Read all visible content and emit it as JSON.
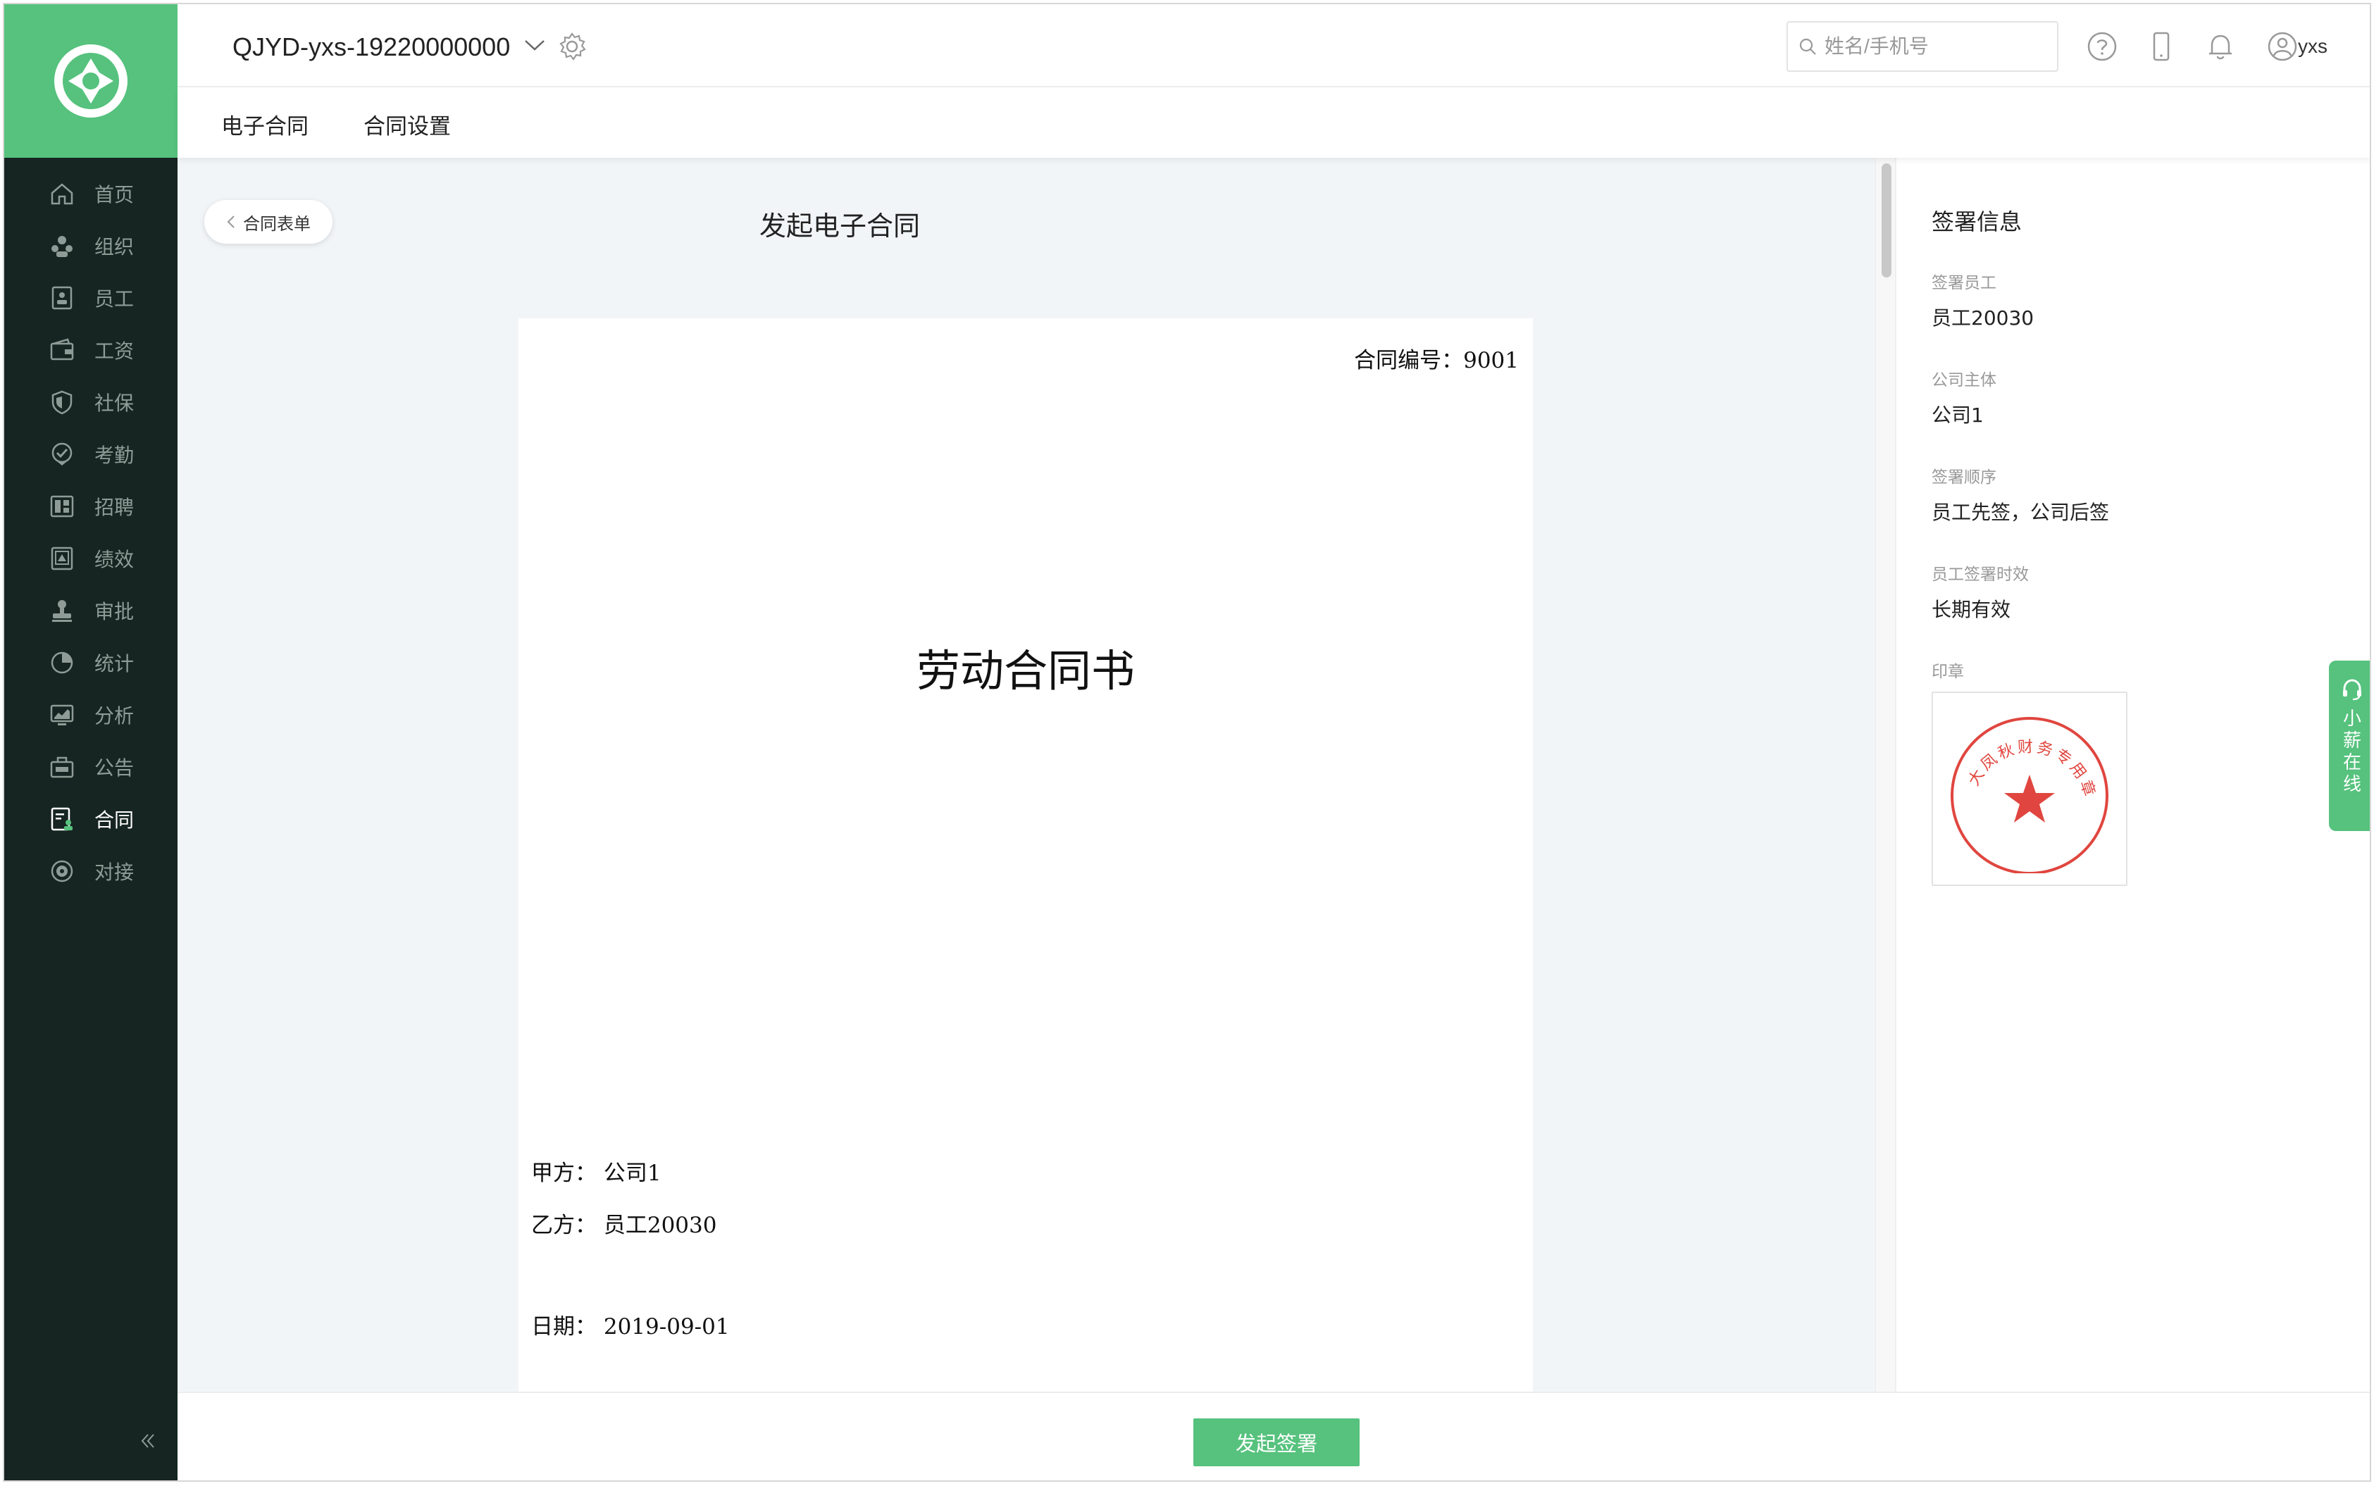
{
  "topbar": {
    "company": "QJYD-yxs-19220000000",
    "search_placeholder": "姓名/手机号",
    "username": "yxs"
  },
  "sidebar": {
    "items": [
      {
        "label": "首页",
        "icon": "home-icon"
      },
      {
        "label": "组织",
        "icon": "org-icon"
      },
      {
        "label": "员工",
        "icon": "employee-icon"
      },
      {
        "label": "工资",
        "icon": "wallet-icon"
      },
      {
        "label": "社保",
        "icon": "shield-icon"
      },
      {
        "label": "考勤",
        "icon": "location-check-icon"
      },
      {
        "label": "招聘",
        "icon": "recruit-icon"
      },
      {
        "label": "绩效",
        "icon": "performance-icon"
      },
      {
        "label": "审批",
        "icon": "stamp-icon"
      },
      {
        "label": "统计",
        "icon": "pie-icon"
      },
      {
        "label": "分析",
        "icon": "analysis-icon"
      },
      {
        "label": "公告",
        "icon": "notice-icon"
      },
      {
        "label": "合同",
        "icon": "contract-icon",
        "active": true
      },
      {
        "label": "对接",
        "icon": "connect-icon"
      }
    ]
  },
  "subnav": {
    "tabs": [
      "电子合同",
      "合同设置"
    ]
  },
  "main": {
    "back_label": "合同表单",
    "title": "发起电子合同"
  },
  "document": {
    "contract_no": "合同编号：9001",
    "title": "劳动合同书",
    "party_a": "甲方：  公司1",
    "party_b": "乙方：  员工20030",
    "date": "日期：  2019-09-01"
  },
  "panel": {
    "title": "签署信息",
    "fields": [
      {
        "label": "签署员工",
        "value": "员工20030"
      },
      {
        "label": "公司主体",
        "value": "公司1"
      },
      {
        "label": "签署顺序",
        "value": "员工先签，公司后签"
      },
      {
        "label": "员工签署时效",
        "value": "长期有效"
      }
    ],
    "seal_label": "印章",
    "seal_text": "大凤秋财务专用章"
  },
  "float_service": {
    "text": "小薪在线"
  },
  "bottom": {
    "submit_label": "发起签署"
  },
  "colors": {
    "accent": "#56c27d",
    "sidebar_bg": "#162521",
    "seal_red": "#e0463f"
  }
}
